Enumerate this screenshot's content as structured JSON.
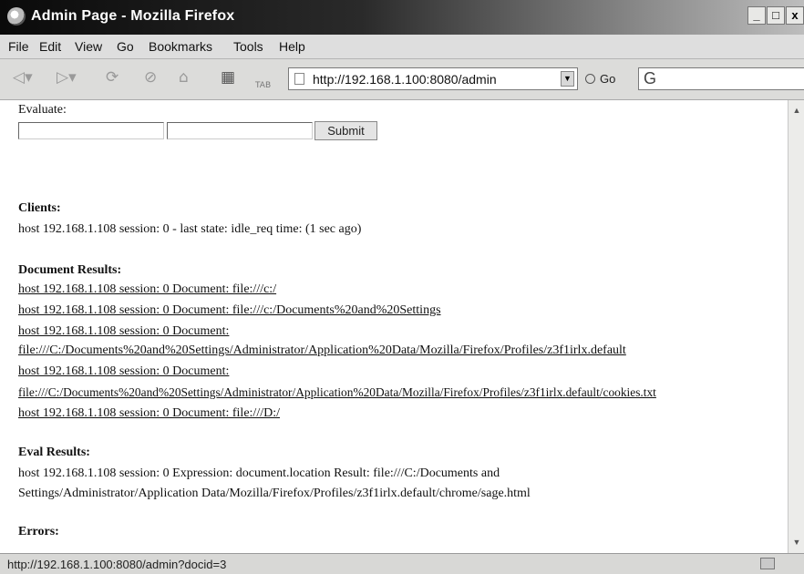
{
  "window": {
    "title": "Admin Page - Mozilla Firefox",
    "controls": {
      "minimize": "_",
      "maximize": "□",
      "close": "x"
    }
  },
  "menu": {
    "items": [
      {
        "label": "File"
      },
      {
        "label": "Edit"
      },
      {
        "label": "View"
      },
      {
        "label": "Go"
      },
      {
        "label": "Bookmarks"
      },
      {
        "label": "Tools"
      },
      {
        "label": "Help"
      }
    ]
  },
  "toolbar": {
    "icons": [
      "back-icon",
      "forward-icon",
      "reload-icon",
      "stop-icon",
      "home-icon",
      "screenshot-icon",
      "tab-icon"
    ],
    "tab_label": "TAB",
    "url": "http://192.168.1.100:8080/admin",
    "go_label": "Go",
    "search_engine_glyph": "G"
  },
  "page": {
    "evaluate_label": "Evaluate:",
    "input1_value": "",
    "input2_value": "",
    "submit_label": "Submit",
    "clients": {
      "heading": "Clients:",
      "line": "host 192.168.1.108 session: 0 - last state: idle_req time: (1 sec ago)"
    },
    "document_results": {
      "heading": "Document Results:",
      "lines": [
        "host 192.168.1.108 session: 0 Document: file:///c:/",
        "host 192.168.1.108 session: 0 Document: file:///c:/Documents%20and%20Settings",
        "host 192.168.1.108 session: 0 Document:",
        "file:///C:/Documents%20and%20Settings/Administrator/Application%20Data/Mozilla/Firefox/Profiles/z3f1irlx.default",
        "host 192.168.1.108 session: 0 Document:",
        "file:///C:/Documents%20and%20Settings/Administrator/Application%20Data/Mozilla/Firefox/Profiles/z3f1irlx.default/cookies.txt",
        "host 192.168.1.108 session: 0 Document: file:///D:/"
      ]
    },
    "eval_results": {
      "heading": "Eval Results:",
      "lines": [
        "host 192.168.1.108 session: 0 Expression: document.location Result: file:///C:/Documents and",
        "Settings/Administrator/Application Data/Mozilla/Firefox/Profiles/z3f1irlx.default/chrome/sage.html"
      ]
    },
    "errors": {
      "heading": "Errors:"
    }
  },
  "status": {
    "text": "http://192.168.1.100:8080/admin?docid=3"
  }
}
